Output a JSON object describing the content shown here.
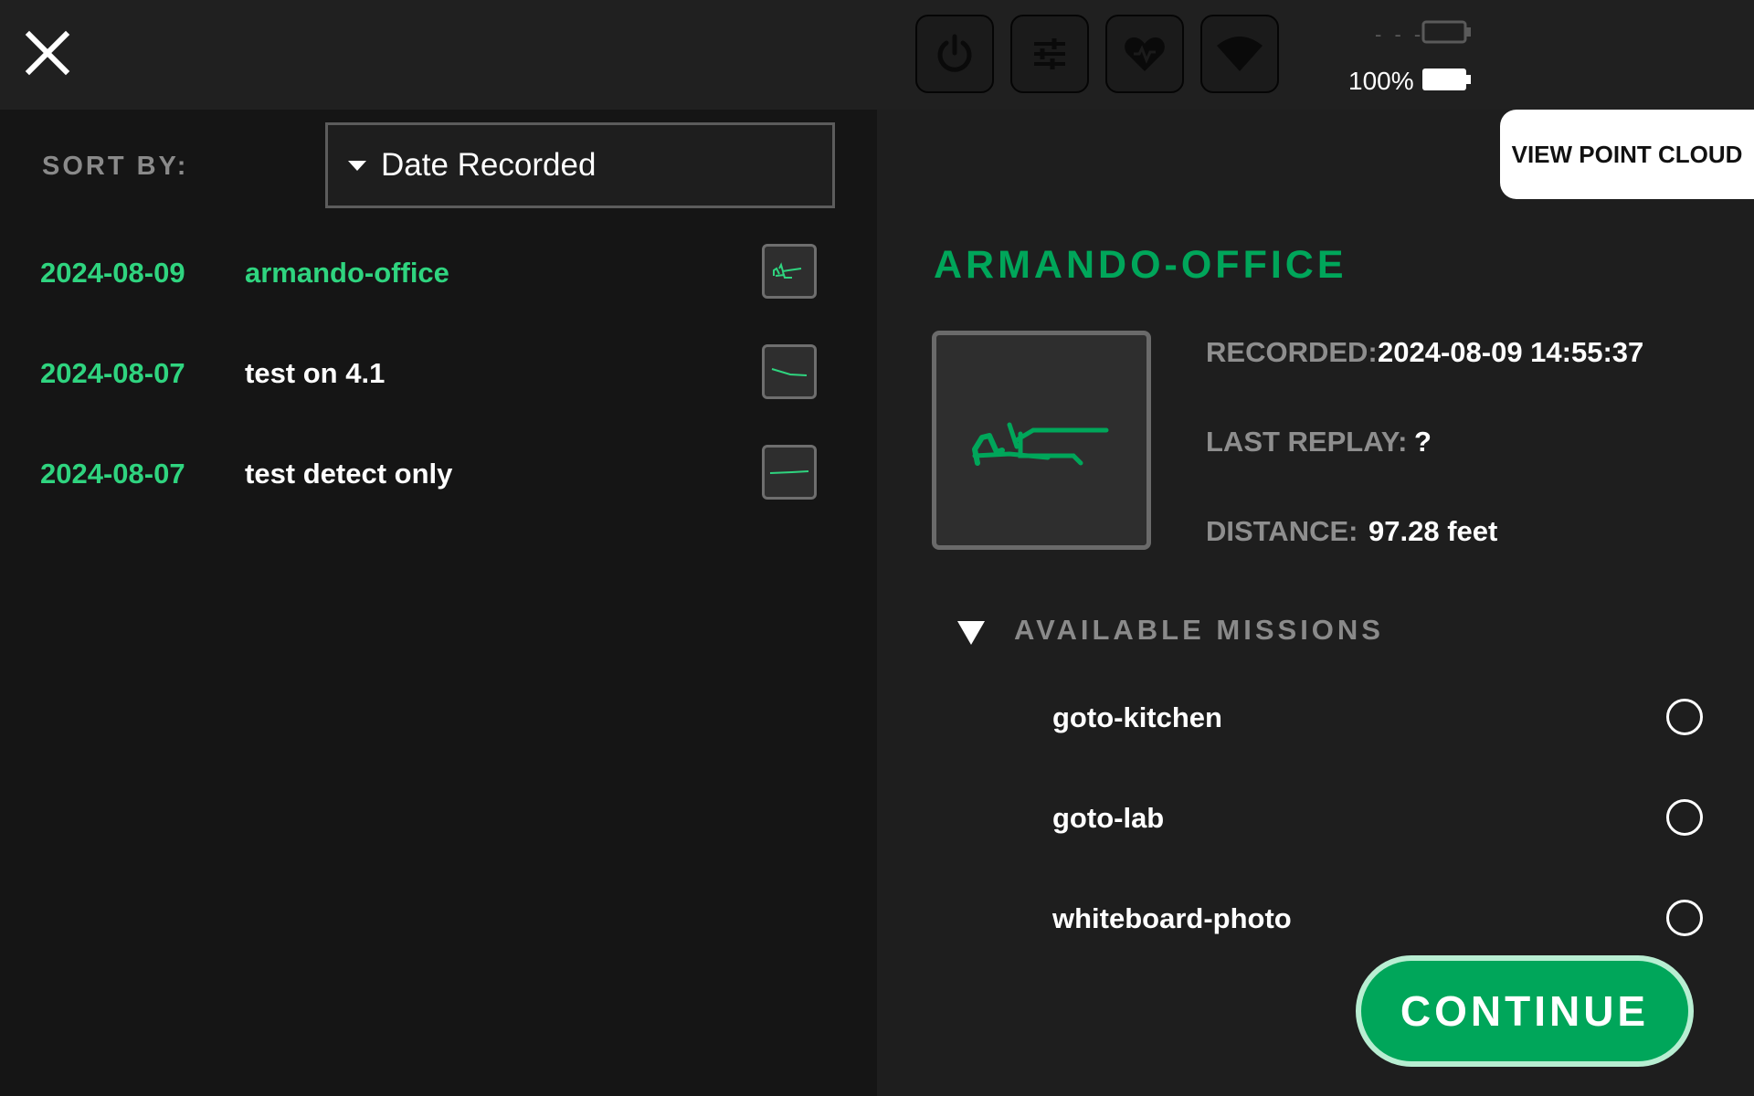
{
  "colors": {
    "accent_green": "#2fd47f",
    "title_green": "#00a65a",
    "panel_dark": "#151515",
    "panel": "#1e1e1e"
  },
  "toolbar": {
    "icons": [
      "power-icon",
      "sliders-icon",
      "heart-icon",
      "wifi-icon"
    ],
    "battery": {
      "percent_label": "100%",
      "level": 1.0,
      "secondary_label": "- - -",
      "secondary_level": 0
    }
  },
  "sort": {
    "label": "SORT BY:",
    "selected": "Date Recorded"
  },
  "maps": [
    {
      "date": "2024-08-09",
      "name": "armando-office",
      "selected": true
    },
    {
      "date": "2024-08-07",
      "name": "test on 4.1",
      "selected": false
    },
    {
      "date": "2024-08-07",
      "name": "test detect only",
      "selected": false
    }
  ],
  "detail": {
    "view_cloud_label": "VIEW POINT CLOUD",
    "title": "ARMANDO-OFFICE",
    "recorded_label": "RECORDED:",
    "recorded_value": "2024-08-09 14:55:37",
    "last_replay_label": "LAST REPLAY:",
    "last_replay_value": "?",
    "distance_label": "DISTANCE:",
    "distance_value": "97.28 feet"
  },
  "missions": {
    "title": "AVAILABLE MISSIONS",
    "items": [
      {
        "name": "goto-kitchen",
        "selected": false
      },
      {
        "name": "goto-lab",
        "selected": false
      },
      {
        "name": "whiteboard-photo",
        "selected": false
      }
    ]
  },
  "continue_label": "CONTINUE"
}
